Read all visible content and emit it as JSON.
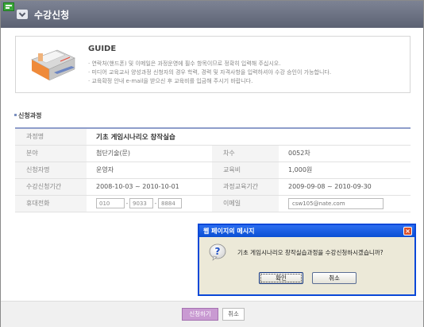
{
  "header": {
    "title": "수강신청",
    "favicon_icon": "ie-green-page-icon",
    "chevron_icon": "chevron-down-icon"
  },
  "guide": {
    "title": "GUIDE",
    "lines": [
      "· 연락처(핸드폰) 및 이메일은 과정운영에 필수 항목이므로 정확히 입력해 주십시오.",
      "· 미디어 교육교사 양성과정 신청자의 경우 학력, 경력 및 자격사항을 입력하셔야 수강 승인이 가능합니다.",
      "· 교육확정 안내 e-mail을 받으신 후 교육비를 입금해 주시기 바랍니다."
    ]
  },
  "section": {
    "title": "신청과정"
  },
  "form": {
    "course_label": "과정명",
    "course_value": "기초 게임시나리오 창작실습",
    "field_label": "분야",
    "field_value": "첨단기술(문)",
    "round_label": "차수",
    "round_value": "0052차",
    "applicant_label": "신청자명",
    "applicant_value": "운영자",
    "fee_label": "교육비",
    "fee_value": "1,000원",
    "apply_period_label": "수강신청기간",
    "apply_period_value": "2008-10-03 ~ 2010-10-01",
    "course_period_label": "과정교육기간",
    "course_period_value": "2009-09-08 ~ 2010-09-30",
    "phone_label": "휴대전화",
    "phone_1": "010",
    "phone_2": "9033",
    "phone_3": "8884",
    "phone_sep": "-",
    "email_label": "이메일",
    "email_value": "csw105@nate.com"
  },
  "footer": {
    "apply_button": "신청하기",
    "cancel_button": "취소"
  },
  "dialog": {
    "title": "웹 페이지의 메시지",
    "message": "기초 게임시나리오 창작실습과정을 수강신청하시겠습니까?",
    "ok_button": "확인",
    "cancel_button": "취소",
    "icon": "question-icon",
    "close_icon": "close-icon"
  },
  "colors": {
    "titlebar": "#6b7182",
    "table_top_border": "#8f9ecb",
    "apply_button": "#c99ad2",
    "dialog_title": "#0a4fd3"
  }
}
